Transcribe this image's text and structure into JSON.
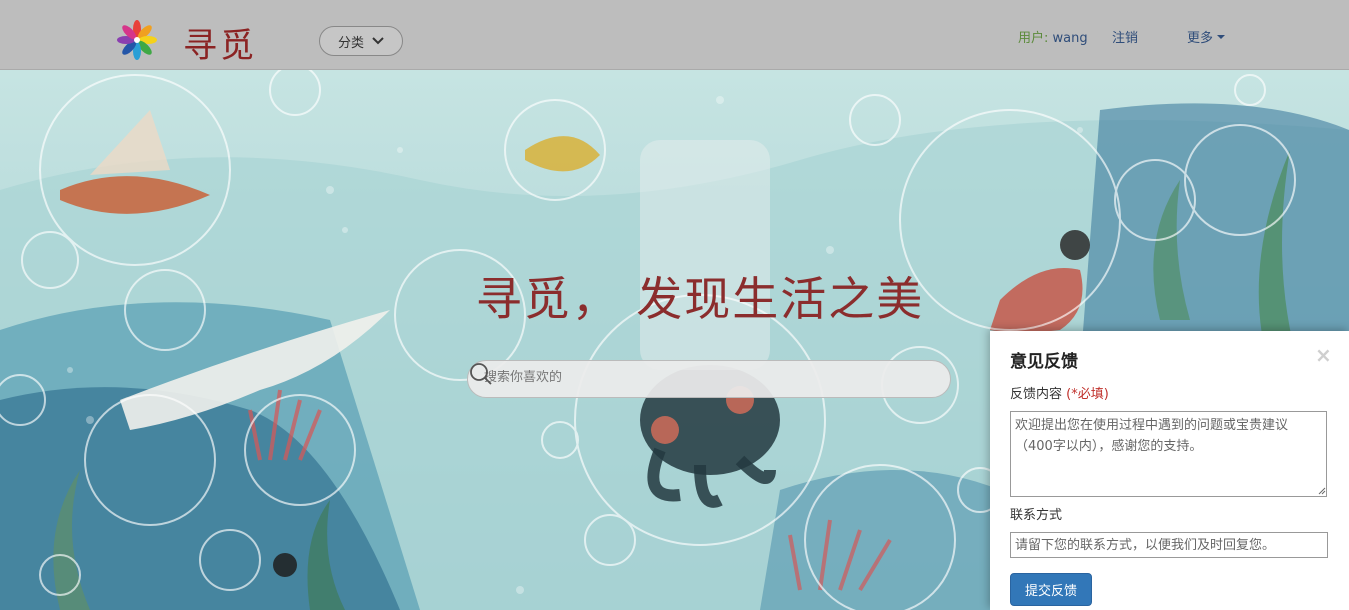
{
  "header": {
    "logo_icon": "colorful-flower-logo",
    "logo_text": "寻觅",
    "category_label": "分类",
    "user_label": "用户:",
    "user_name": "wang",
    "logout_label": "注销",
    "more_label": "更多"
  },
  "hero": {
    "title": "寻觅， 发现生活之美",
    "search_placeholder": "搜索你喜欢的",
    "search_icon": "search-icon"
  },
  "feedback": {
    "title": "意见反馈",
    "close_symbol": "×",
    "content_label": "反馈内容",
    "required_label": "(*必填)",
    "content_placeholder": "欢迎提出您在使用过程中遇到的问题或宝贵建议（400字以内），感谢您的支持。",
    "contact_label": "联系方式",
    "contact_placeholder": "请留下您的联系方式，以便我们及时回复您。",
    "submit_label": "提交反馈"
  },
  "colors": {
    "brand_red": "#8b2d2d",
    "button_blue": "#3277b8",
    "link_blue": "#2f4d7a",
    "required_red": "#c0302b"
  }
}
